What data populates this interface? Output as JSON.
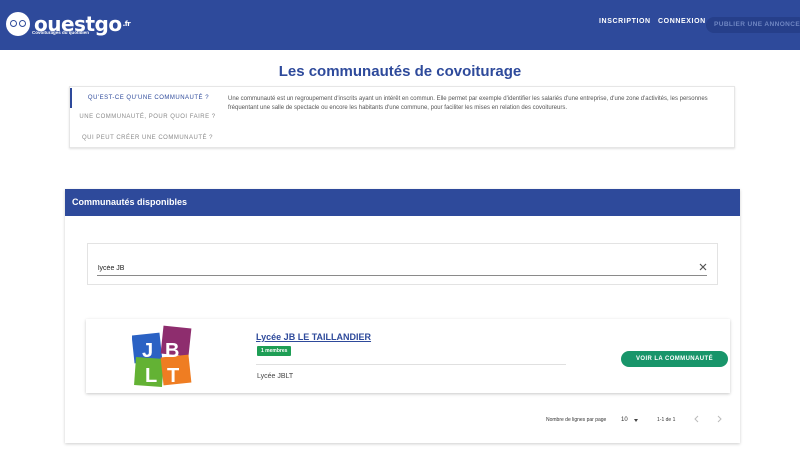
{
  "header": {
    "brand": "ouestgo",
    "brand_suffix": ".fr",
    "tagline": "Covoiturages du quotidien",
    "nav": [
      "INSCRIPTION",
      "CONNEXION"
    ],
    "publish_label": "PUBLIER UNE ANNONCE",
    "brand_color": "#2e4a9b"
  },
  "page": {
    "title": "Les communautés de covoiturage"
  },
  "info": {
    "tabs": [
      "QU'EST-CE QU'UNE COMMUNAUTÉ ?",
      "UNE COMMUNAUTÉ, POUR QUOI FAIRE ?",
      "QUI PEUT CRÉER UNE COMMUNAUTÉ ?"
    ],
    "active_tab": 0,
    "text": "Une communauté est un regroupement d'inscrits ayant un intérêt en commun. Elle permet par exemple d'identifier les salariés d'une entreprise, d'une zone d'activités, les personnes fréquentant une salle de spectacle ou encore les habitants d'une commune, pour faciliter les mises en relation des covoitureurs."
  },
  "communities": {
    "heading": "Communautés disponibles",
    "search": {
      "value": "lycée JB"
    },
    "items": [
      {
        "name": "Lycée JB LE TAILLANDIER",
        "members": "1 membres",
        "description": "Lycée JBLT",
        "logo_letters": [
          "J",
          "B",
          "L",
          "T"
        ],
        "logo_colors": [
          "#2b62c4",
          "#8e2d6e",
          "#63b234",
          "#ef7d22"
        ],
        "action_label": "VOIR LA COMMUNAUTÉ"
      }
    ],
    "pagination": {
      "rows_label": "Nombre de lignes par page",
      "rows_per_page": "10",
      "range": "1-1 de 1"
    },
    "accent_green": "#18956a"
  }
}
